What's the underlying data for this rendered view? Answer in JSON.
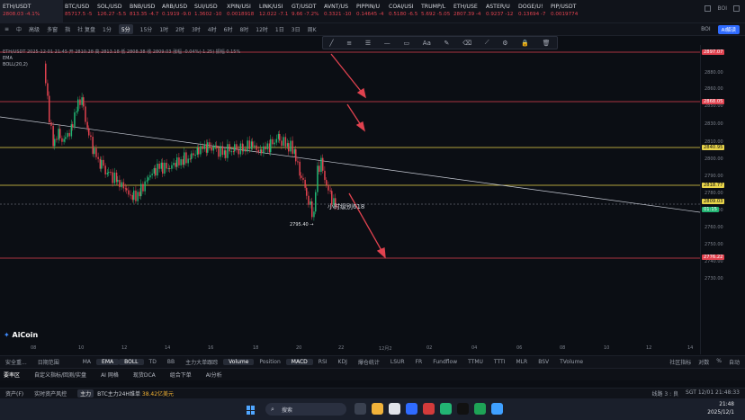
{
  "tickers": [
    {
      "symbol": "ETH/USDT",
      "price": "2808.03 -4.1%",
      "up": false
    },
    {
      "symbol": "BTC/USD",
      "price": "85717.5 -5",
      "up": false
    },
    {
      "symbol": "SOL/USD",
      "price": "126.27 -5.5",
      "up": false
    },
    {
      "symbol": "BNB/USD",
      "price": "813.35 -4.7",
      "up": false
    },
    {
      "symbol": "ARB/USD",
      "price": "0.1919 -9.0",
      "up": false
    },
    {
      "symbol": "SUI/USD",
      "price": "1.3602 -10",
      "up": false
    },
    {
      "symbol": "XPIN/USI",
      "price": "0.0018918",
      "up": false
    },
    {
      "symbol": "LINK/USI",
      "price": "12.022 -7.1",
      "up": false
    },
    {
      "symbol": "GT/USDT",
      "price": "9.66 -7.2%",
      "up": false
    },
    {
      "symbol": "AVNT/US",
      "price": "0.3321 -10",
      "up": false
    },
    {
      "symbol": "PIPPIN/U",
      "price": "0.14645 -4",
      "up": false
    },
    {
      "symbol": "COAI/USI",
      "price": "0.5180 -6.5",
      "up": false
    },
    {
      "symbol": "TRUMP/L",
      "price": "5.692 -5.05",
      "up": false
    },
    {
      "symbol": "ETH/USE",
      "price": "2807.39 -4",
      "up": false
    },
    {
      "symbol": "ASTER/U",
      "price": "0.9237 -12",
      "up": false
    },
    {
      "symbol": "DOGE/U!",
      "price": "0.13694 -7",
      "up": false
    },
    {
      "symbol": "BOI",
      "price": "",
      "up": false
    },
    {
      "symbol": "PIP/USDT",
      "price": "0.0019774",
      "up": false
    }
  ],
  "toolbar": {
    "items": [
      "≡",
      "中",
      "高级",
      "多窗",
      "指",
      "社 复盘",
      "1分",
      "5分",
      "15分",
      "1时",
      "2时",
      "3时",
      "4时",
      "6时",
      "8时",
      "12时",
      "1日",
      "3日",
      "周K"
    ],
    "active_timeframe": "5分",
    "right_items": [
      "BOI",
      "AI解读"
    ]
  },
  "chart_info": {
    "symbol_line": "ETH/USDT  2025-12-01 21:45  开 2810.28  高 2813.18  低 2808.38  收 2809.03  涨幅 -0.04%(-1.25)  振幅 0.15%",
    "ema_label": "EMA",
    "boll_label": "BOLL(20,2)"
  },
  "annotation": "小时级别618",
  "low_label": "2795.40 →",
  "price_ticks": [
    "2880.00",
    "2860.00",
    "2850.00",
    "2830.00",
    "2810.00",
    "2800.00",
    "2790.00",
    "2780.00",
    "2770.00",
    "2760.00",
    "2750.00",
    "2740.00",
    "2730.00"
  ],
  "price_tags": [
    {
      "label": "2897.07",
      "color": "#e0424f"
    },
    {
      "label": "2868.05",
      "color": "#e0424f"
    },
    {
      "label": "2840.95",
      "color": "#e8d44a"
    },
    {
      "label": "2818.77",
      "color": "#e8d44a"
    },
    {
      "label": "2809.03",
      "color": "#e8d44a"
    },
    {
      "label": "01:15",
      "color": "#22b573"
    },
    {
      "label": "2776.22",
      "color": "#e0424f"
    }
  ],
  "time_ticks": [
    "08",
    "10",
    "12",
    "14",
    "16",
    "18",
    "20",
    "22",
    "12月2",
    "02",
    "04",
    "06",
    "08",
    "10",
    "12",
    "14",
    "16"
  ],
  "indicators": [
    "MA",
    "EMA",
    "BOLL",
    "TD",
    "BB",
    "主力大单跟踪",
    "Volume",
    "Position",
    "MACD",
    "RSI",
    "KDJ",
    "爆仓统计",
    "LSUR",
    "FR",
    "Fundflow",
    "TTMU",
    "TTTI",
    "MLR",
    "BSV",
    "TVolume"
  ],
  "indicator_left": [
    "安全重...",
    "日期范围"
  ],
  "active_indicators": [
    "EMA",
    "BOLL",
    "Volume",
    "MACD"
  ],
  "indicator_right": [
    "社区指标",
    "对数",
    "%",
    "自动"
  ],
  "bottom_tabs": [
    "要率区",
    "自定义指标/回测/实盘",
    "AI 网格",
    "现货DCA",
    "组合下单",
    "AI分析"
  ],
  "status": {
    "tabs": [
      "资产(F)",
      "实时资产风控"
    ],
    "badge": "主力",
    "news_prefix": "BTC主力24H维单",
    "news_amount": "38.42亿美元",
    "right": [
      "线路 3 : 良",
      "SGT  12/01 21:48:33"
    ]
  },
  "taskbar": {
    "search_placeholder": "搜索",
    "time": "21:48",
    "date": "2025/12/1"
  },
  "logo_text": "AiCoin",
  "colors": {
    "background": "#0b0e14",
    "red_line": "#e0424f",
    "yellow_line": "#e8d44a",
    "up": "#22b573",
    "down": "#e0424f",
    "accent": "#2f6bff"
  }
}
